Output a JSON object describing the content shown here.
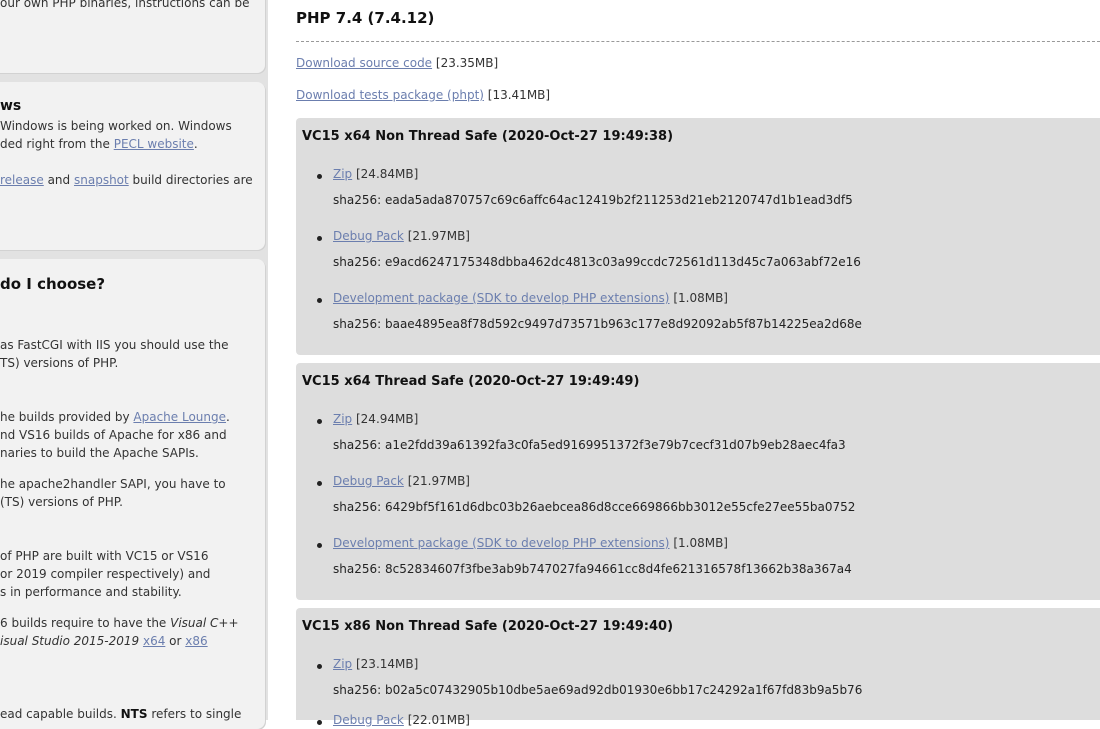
{
  "sidebar": {
    "box1": {
      "line1": "our own PHP binaries, instructions can be"
    },
    "box2": {
      "heading": "ws",
      "line1": "Windows is being worked on. Windows",
      "line2_pre": "ded right from the ",
      "line2_link": "PECL website",
      "line2_post": ".",
      "line3_link1": "release",
      "line3_mid": " and ",
      "line3_link2": "snapshot",
      "line3_post": " build directories are"
    },
    "box3": {
      "heading": "do I choose?",
      "p1_l1": " as FastCGI with IIS you should use the",
      "p1_l2": "TS) versions of PHP.",
      "p2_l1_pre": "he builds provided by ",
      "p2_l1_link": "Apache Lounge",
      "p2_l1_post": ".",
      "p2_l2": "nd VS16 builds of Apache for x86 and",
      "p2_l3": "naries to build the Apache SAPIs.",
      "p3_l1": "he apache2handler SAPI, you have to",
      "p3_l2": "(TS) versions of PHP.",
      "p4_l1": " of PHP are built with VC15 or VS16",
      "p4_l2": "or 2019 compiler respectively) and",
      "p4_l3": "s in performance and stability.",
      "p5_l1_pre": "6 builds require to have the ",
      "p5_l1_italic": "Visual C++",
      "p5_l2_italic": "isual Studio 2015-2019",
      "p5_l2_link1": "x64",
      "p5_l2_mid": " or ",
      "p5_l2_link2": "x86",
      "p6_l1_pre": "ead capable builds. ",
      "p6_l1_bold": "NTS",
      "p6_l1_post": " refers to single"
    }
  },
  "release": {
    "title": "PHP 7.4 (7.4.12)",
    "source_link": "Download source code",
    "source_size": " [23.35MB]",
    "tests_link": "Download tests package (phpt)",
    "tests_size": " [13.41MB]"
  },
  "builds": [
    {
      "title": "VC15 x64 Non Thread Safe (2020-Oct-27 19:49:38)",
      "packages": [
        {
          "link": "Zip",
          "size": " [24.84MB]",
          "sha": "sha256: eada5ada870757c69c6affc64ac12419b2f211253d21eb2120747d1b1ead3df5"
        },
        {
          "link": "Debug Pack",
          "size": " [21.97MB]",
          "sha": "sha256: e9acd6247175348dbba462dc4813c03a99ccdc72561d113d45c7a063abf72e16"
        },
        {
          "link": "Development package (SDK to develop PHP extensions)",
          "size": " [1.08MB]",
          "sha": "sha256: baae4895ea8f78d592c9497d73571b963c177e8d92092ab5f87b14225ea2d68e"
        }
      ]
    },
    {
      "title": "VC15 x64 Thread Safe (2020-Oct-27 19:49:49)",
      "packages": [
        {
          "link": "Zip",
          "size": " [24.94MB]",
          "sha": "sha256: a1e2fdd39a61392fa3c0fa5ed9169951372f3e79b7cecf31d07b9eb28aec4fa3"
        },
        {
          "link": "Debug Pack",
          "size": " [21.97MB]",
          "sha": "sha256: 6429bf5f161d6dbc03b26aebcea86d8cce669866bb3012e55cfe27ee55ba0752"
        },
        {
          "link": "Development package (SDK to develop PHP extensions)",
          "size": " [1.08MB]",
          "sha": "sha256: 8c52834607f3fbe3ab9b747027fa94661cc8d4fe621316578f13662b38a367a4"
        }
      ]
    },
    {
      "title": "VC15 x86 Non Thread Safe (2020-Oct-27 19:49:40)",
      "packages": [
        {
          "link": "Zip",
          "size": " [23.14MB]",
          "sha": "sha256: b02a5c07432905b10dbe5ae69ad92db01930e6bb17c24292a1f67fd83b9a5b76"
        },
        {
          "link": "Debug Pack",
          "size": " [22.01MB]",
          "sha": ""
        }
      ]
    }
  ]
}
